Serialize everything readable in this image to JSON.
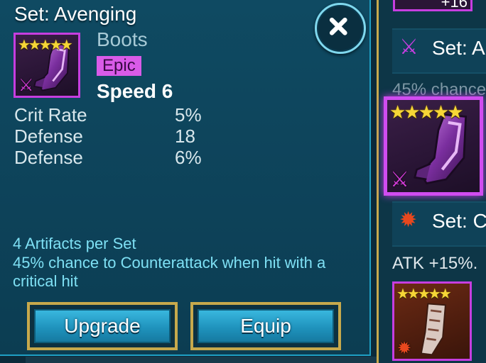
{
  "item": {
    "set_title": "Set: Avenging",
    "type": "Boots",
    "rarity": "Epic",
    "primary_stat": "Speed 6",
    "stars": "★★★★★",
    "star_count": 5,
    "substats": [
      {
        "name": "Crit Rate",
        "value": "5%"
      },
      {
        "name": "Defense",
        "value": "18"
      },
      {
        "name": "Defense",
        "value": "6%"
      }
    ],
    "set_count": "4 Artifacts per Set",
    "set_description": "45% chance to Counterattack when hit with a critical hit"
  },
  "buttons": {
    "upgrade": "Upgrade",
    "equip": "Equip",
    "close_icon": "close-icon"
  },
  "side_list": {
    "top_level": "+16",
    "entries": [
      {
        "title": "Set: A",
        "text": "45% chance",
        "icon": "avenging-set-icon",
        "stars": "★★★★★"
      },
      {
        "title": "Set: C",
        "text": "ATK +15%.",
        "icon": "cursed-set-icon",
        "stars": "★★★★★"
      }
    ]
  },
  "colors": {
    "panel_bg": "#0f4a62",
    "accent_cyan": "#7ee0f4",
    "epic_purple": "#d95be8",
    "button_blue": "#1f93bd",
    "gold_border": "#c7a94c"
  }
}
